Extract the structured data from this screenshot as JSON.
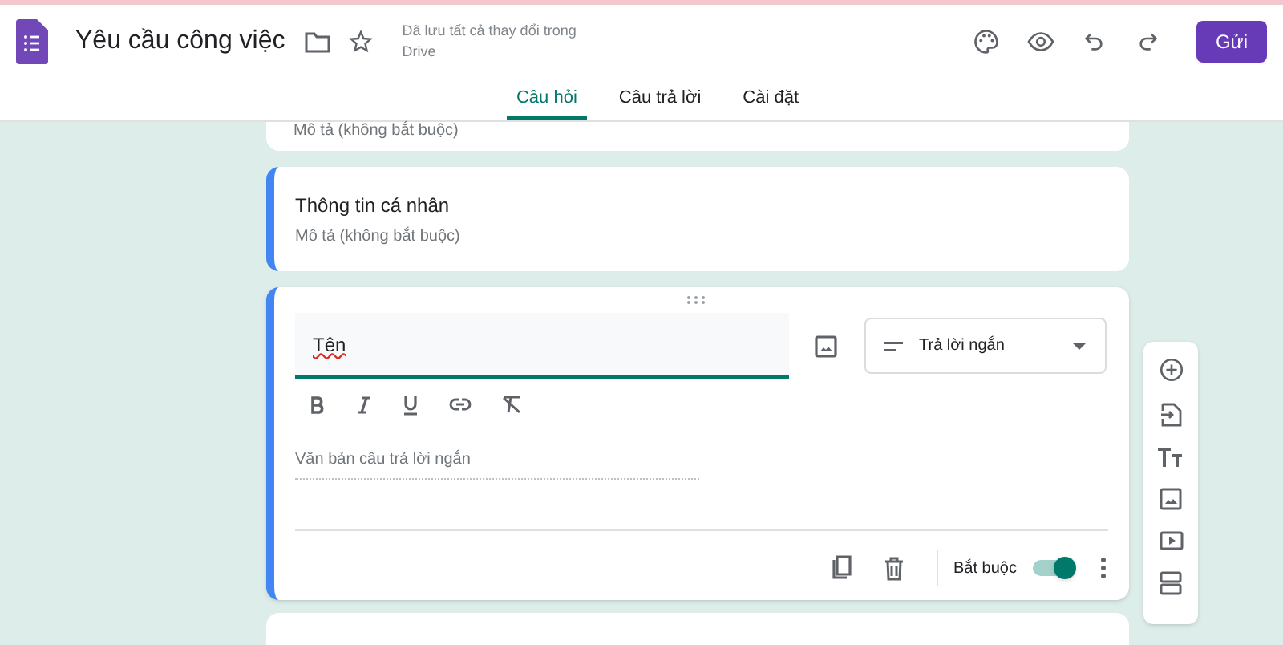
{
  "header": {
    "title": "Yêu cầu công việc",
    "save_status": "Đã lưu tất cả thay đổi trong Drive",
    "send_button": "Gửi"
  },
  "tabs": [
    {
      "label": "Câu hỏi",
      "selected": true
    },
    {
      "label": "Câu trả lời",
      "selected": false
    },
    {
      "label": "Cài đặt",
      "selected": false
    }
  ],
  "sections": [
    {
      "description_placeholder": "Mô tả (không bắt buộc)"
    },
    {
      "title": "Thông tin cá nhân",
      "description_placeholder": "Mô tả (không bắt buộc)"
    }
  ],
  "question": {
    "title": "Tên",
    "type": "Trả lời ngắn",
    "answer_placeholder": "Văn bản câu trả lời ngắn",
    "required_label": "Bắt buộc",
    "required": true
  }
}
